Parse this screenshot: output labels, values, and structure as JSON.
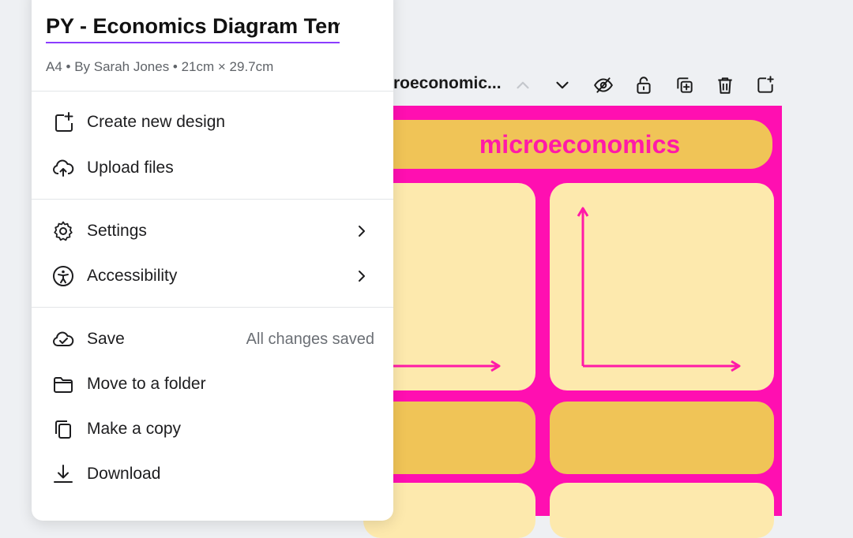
{
  "toolbar": {
    "page_name": "roeconomic...",
    "buttons": [
      "chevron-up-icon",
      "chevron-down-icon",
      "hide-icon",
      "lock-icon",
      "duplicate-icon",
      "trash-icon",
      "add-page-icon"
    ]
  },
  "canvas": {
    "heading": "microeconomics",
    "colors": {
      "background": "#ff0fb1",
      "header": "#f0c457",
      "panel": "#fde9ad",
      "accent": "#ff1aa8"
    }
  },
  "menu": {
    "title": "PY - Economics Diagram Temp",
    "meta": "A4 • By Sarah Jones • 21cm × 29.7cm",
    "items": [
      {
        "icon": "plus-square-icon",
        "label": "Create new design"
      },
      {
        "icon": "cloud-upload-icon",
        "label": "Upload files"
      },
      {
        "icon": "gear-icon",
        "label": "Settings",
        "submenu": true
      },
      {
        "icon": "accessibility-icon",
        "label": "Accessibility",
        "submenu": true
      },
      {
        "icon": "cloud-check-icon",
        "label": "Save",
        "status": "All changes saved"
      },
      {
        "icon": "folder-icon",
        "label": "Move to a folder"
      },
      {
        "icon": "copy-icon",
        "label": "Make a copy"
      },
      {
        "icon": "download-icon",
        "label": "Download"
      }
    ]
  }
}
